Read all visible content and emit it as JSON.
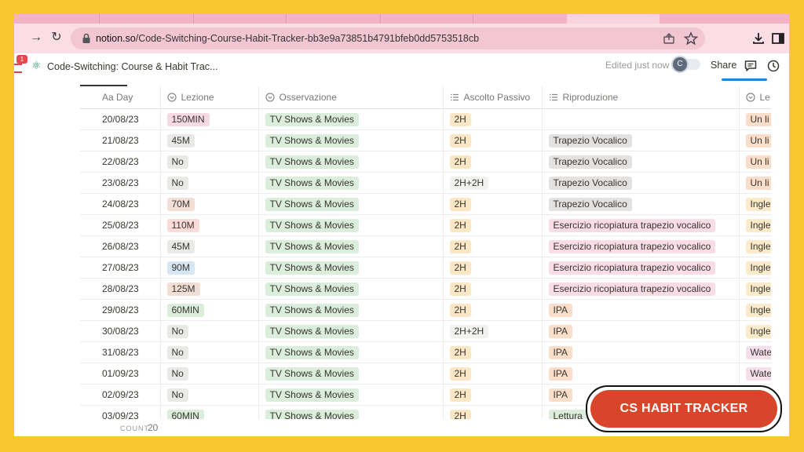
{
  "browser": {
    "url_host": "notion.so",
    "url_path": "/Code-Switching-Course-Habit-Tracker-bb3e9a73851b4791bfeb0dd5753518cb",
    "notification_count": "1"
  },
  "notion": {
    "page_icon": "⚛",
    "page_title": "Code-Switching: Course & Habit Trac...",
    "edited": "Edited just now",
    "avatar_initial": "C",
    "share_label": "Share"
  },
  "table": {
    "columns": [
      "Aa Day",
      "Lezione",
      "Osservazione",
      "Ascolto Passivo",
      "Riproduzione",
      "Le"
    ],
    "column_icons": [
      "text-icon",
      "select-icon",
      "select-icon",
      "list-icon",
      "list-icon",
      "select-icon"
    ],
    "rows": [
      {
        "day": "20/08/23",
        "lezione": "150MIN",
        "lezione_color": "#F6D9E3",
        "oss": "TV Shows & Movies",
        "ascolto": "2H",
        "ascolto_color": "#FBE7C6",
        "rip": "",
        "rip_color": "",
        "le": "Un li",
        "le_color": "#FADEC9"
      },
      {
        "day": "21/08/23",
        "lezione": "45M",
        "lezione_color": "#E9E9E7",
        "oss": "TV Shows & Movies",
        "ascolto": "2H",
        "ascolto_color": "#FBE7C6",
        "rip": "Trapezio Vocalico",
        "rip_color": "#E3E2E0",
        "le": "Un li",
        "le_color": "#FADEC9"
      },
      {
        "day": "22/08/23",
        "lezione": "No",
        "lezione_color": "#E9E9E7",
        "oss": "TV Shows & Movies",
        "ascolto": "2H",
        "ascolto_color": "#FBE7C6",
        "rip": "Trapezio Vocalico",
        "rip_color": "#E3E2E0",
        "le": "Un li",
        "le_color": "#FADEC9"
      },
      {
        "day": "23/08/23",
        "lezione": "No",
        "lezione_color": "#E9E9E7",
        "oss": "TV Shows & Movies",
        "ascolto": "2H+2H",
        "ascolto_color": "#F1F1EF",
        "rip": "Trapezio Vocalico",
        "rip_color": "#E3E2E0",
        "le": "Un li",
        "le_color": "#FADEC9"
      },
      {
        "day": "24/08/23",
        "lezione": "70M",
        "lezione_color": "#F1DFD6",
        "oss": "TV Shows & Movies",
        "ascolto": "2H",
        "ascolto_color": "#FBE7C6",
        "rip": "Trapezio Vocalico",
        "rip_color": "#E3E2E0",
        "le": "Ingle",
        "le_color": "#FBEBCB"
      },
      {
        "day": "25/08/23",
        "lezione": "110M",
        "lezione_color": "#FADBD8",
        "oss": "TV Shows & Movies",
        "ascolto": "2H",
        "ascolto_color": "#FBE7C6",
        "rip": "Esercizio ricopiatura trapezio vocalico",
        "rip_color": "#F9DCE6",
        "le": "Ingle",
        "le_color": "#FBEBCB"
      },
      {
        "day": "26/08/23",
        "lezione": "45M",
        "lezione_color": "#E9E9E7",
        "oss": "TV Shows & Movies",
        "ascolto": "2H",
        "ascolto_color": "#FBE7C6",
        "rip": "Esercizio ricopiatura trapezio vocalico",
        "rip_color": "#F9DCE6",
        "le": "Ingle",
        "le_color": "#FBEBCB"
      },
      {
        "day": "27/08/23",
        "lezione": "90M",
        "lezione_color": "#D6E6F4",
        "oss": "TV Shows & Movies",
        "ascolto": "2H",
        "ascolto_color": "#FBE7C6",
        "rip": "Esercizio ricopiatura trapezio vocalico",
        "rip_color": "#F9DCE6",
        "le": "Ingle",
        "le_color": "#FBEBCB"
      },
      {
        "day": "28/08/23",
        "lezione": "125M",
        "lezione_color": "#F1DFD6",
        "oss": "TV Shows & Movies",
        "ascolto": "2H",
        "ascolto_color": "#FBE7C6",
        "rip": "Esercizio ricopiatura trapezio vocalico",
        "rip_color": "#F9DCE6",
        "le": "Ingle",
        "le_color": "#FBEBCB"
      },
      {
        "day": "29/08/23",
        "lezione": "60MIN",
        "lezione_color": "#DBEDDB",
        "oss": "TV Shows & Movies",
        "ascolto": "2H",
        "ascolto_color": "#FBE7C6",
        "rip": "IPA",
        "rip_color": "#FADEC9",
        "le": "Ingle",
        "le_color": "#FBEBCB"
      },
      {
        "day": "30/08/23",
        "lezione": "No",
        "lezione_color": "#E9E9E7",
        "oss": "TV Shows & Movies",
        "ascolto": "2H+2H",
        "ascolto_color": "#F1F1EF",
        "rip": "IPA",
        "rip_color": "#FADEC9",
        "le": "Ingle",
        "le_color": "#FBEBCB"
      },
      {
        "day": "31/08/23",
        "lezione": "No",
        "lezione_color": "#E9E9E7",
        "oss": "TV Shows & Movies",
        "ascolto": "2H",
        "ascolto_color": "#FBE7C6",
        "rip": "IPA",
        "rip_color": "#FADEC9",
        "le": "Wate",
        "le_color": "#F4DFEB"
      },
      {
        "day": "01/09/23",
        "lezione": "No",
        "lezione_color": "#E9E9E7",
        "oss": "TV Shows & Movies",
        "ascolto": "2H",
        "ascolto_color": "#FBE7C6",
        "rip": "IPA",
        "rip_color": "#FADEC9",
        "le": "Wate",
        "le_color": "#F4DFEB"
      },
      {
        "day": "02/09/23",
        "lezione": "No",
        "lezione_color": "#E9E9E7",
        "oss": "TV Shows & Movies",
        "ascolto": "2H",
        "ascolto_color": "#FBE7C6",
        "rip": "IPA",
        "rip_color": "#FADEC9",
        "le": "",
        "le_color": ""
      },
      {
        "day": "03/09/23",
        "lezione": "60MIN",
        "lezione_color": "#DBEDDB",
        "oss": "TV Shows & Movies",
        "ascolto": "2H",
        "ascolto_color": "#FBE7C6",
        "rip": "Lettura",
        "rip_color": "#DBEDDB",
        "le": "",
        "le_color": ""
      }
    ],
    "oss_color": "#DBEDDB",
    "count_label": "COUNT",
    "count_value": "20"
  },
  "cta": {
    "label": "CS HABIT TRACKER",
    "color": "#D9452B"
  }
}
